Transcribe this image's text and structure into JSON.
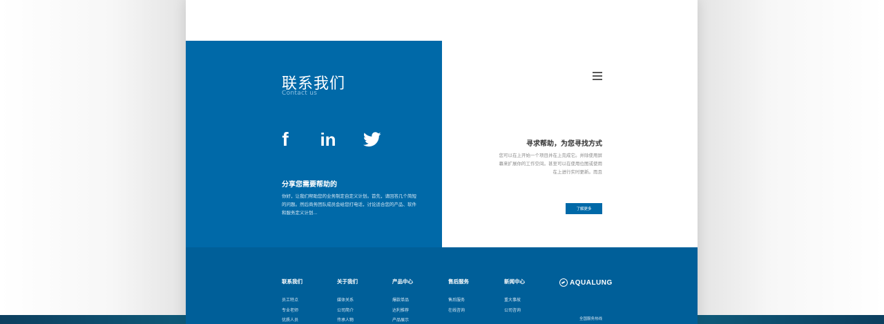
{
  "contact": {
    "title": "联系我们",
    "subtitle": "Contact us",
    "social": {
      "facebook": "f",
      "linkedin": "in",
      "twitter_icon": "twitter-bird-icon"
    },
    "help_heading": "分享您需要帮助的",
    "help_text": "你好，让我们帮助您的业务制定自定义计划。首先，请回答几个简短的问题。然后商务团队成员会给您打电话，讨论适合您的产品、软件和服务定义计划..."
  },
  "seek": {
    "menu_icon": "hamburger-menu-icon",
    "heading": "寻求帮助，为您寻找方式",
    "text": "您可以在上开始一个项目并在上完成它。并除使用屏幕来扩展你的工作空间。甚至可以在使用位图或使用在上进行实时更新。而且",
    "button_label": "了解更多"
  },
  "footer": {
    "columns": [
      {
        "title": "联系我们",
        "links": [
          "员工特点",
          "专业老师",
          "优质人员"
        ]
      },
      {
        "title": "关于我们",
        "links": [
          "媒体关系",
          "公司简介",
          "传承人物"
        ]
      },
      {
        "title": "产品中心",
        "links": [
          "爆款单品",
          "达利推荐",
          "产品展示"
        ]
      },
      {
        "title": "售后服务",
        "links": [
          "售后服务",
          "在线咨询"
        ]
      },
      {
        "title": "新闻中心",
        "links": [
          "重大事故",
          "公司咨询"
        ]
      }
    ],
    "logo_text": "AQUALUNG",
    "hotline_label": "全国服务热线"
  },
  "colors": {
    "primary_blue": "#0069a8",
    "footer_blue": "#005f99"
  }
}
